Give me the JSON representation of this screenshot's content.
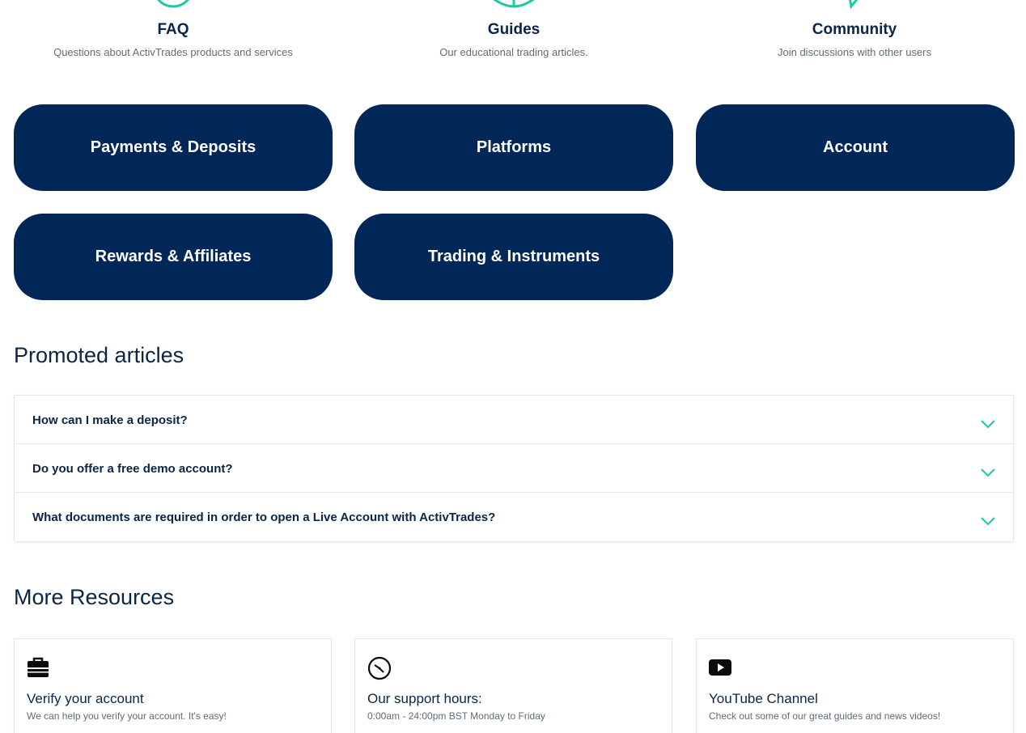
{
  "top_categories": [
    {
      "title": "FAQ",
      "description": "Questions about ActivTrades products and services",
      "icon": "faq-circle-icon"
    },
    {
      "title": "Guides",
      "description": "Our educational trading articles.",
      "icon": "book-icon"
    },
    {
      "title": "Community",
      "description": "Join discussions with other users",
      "icon": "chat-icon"
    }
  ],
  "categories": [
    {
      "label": "Payments & Deposits"
    },
    {
      "label": "Platforms"
    },
    {
      "label": "Account"
    },
    {
      "label": "Rewards & Affiliates"
    },
    {
      "label": "Trading & Instruments"
    }
  ],
  "promoted": {
    "heading": "Promoted articles",
    "articles": [
      {
        "question": "How can I make a deposit?"
      },
      {
        "question": "Do you offer a free demo account?"
      },
      {
        "question": "What documents are required in order to open a Live Account with ActivTrades?"
      }
    ]
  },
  "resources": {
    "heading": "More Resources",
    "cards": [
      {
        "title": "Verify your account",
        "description": "We can help you verify your account. It's easy!",
        "icon": "briefcase-icon"
      },
      {
        "title": "Our support hours:",
        "description": "0:00am - 24:00pm BST Monday to Friday",
        "icon": "clock-icon"
      },
      {
        "title": "YouTube Channel",
        "description": "Check out some of our great guides and news videos!",
        "icon": "youtube-icon"
      }
    ]
  },
  "colors": {
    "navy": "#012758",
    "accent": "#1ec8a0",
    "text_dark": "#0b2545",
    "text_muted": "#5f6b78"
  }
}
